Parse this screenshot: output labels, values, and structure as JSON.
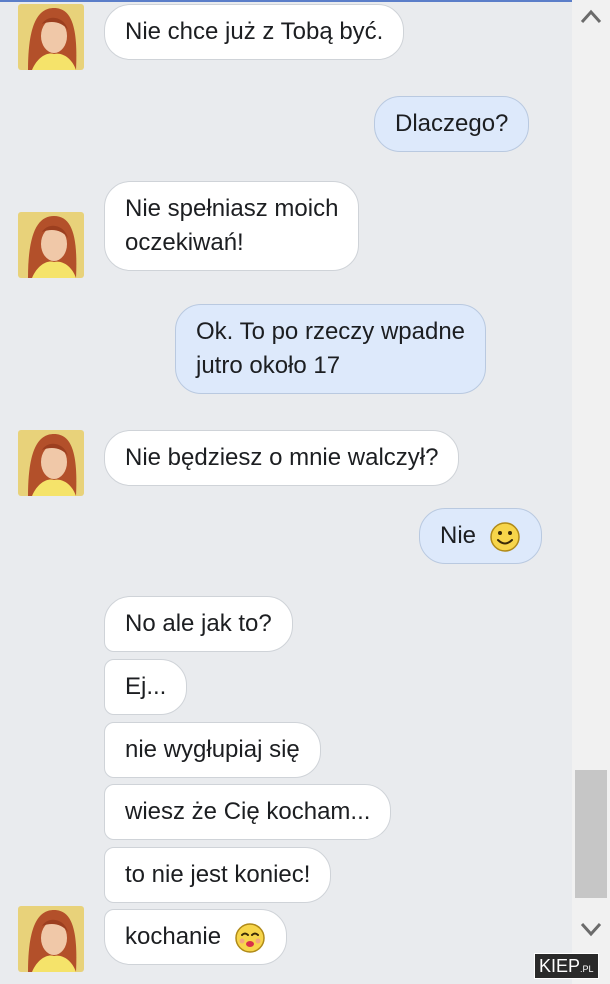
{
  "messages": [
    {
      "side": "in",
      "text": "Nie chce już z Tobą być."
    },
    {
      "side": "out",
      "text": "Dlaczego?"
    },
    {
      "side": "in",
      "lines": [
        "Nie spełniasz moich",
        "oczekiwań!"
      ]
    },
    {
      "side": "out",
      "lines": [
        "Ok. To po rzeczy wpadne",
        "jutro około 17"
      ]
    },
    {
      "side": "in",
      "text": "Nie będziesz o mnie walczył?"
    },
    {
      "side": "out",
      "text": "Nie",
      "emoji": "smiley-icon"
    },
    {
      "side": "in",
      "text": "No ale jak to?"
    },
    {
      "side": "in",
      "text": "Ej..."
    },
    {
      "side": "in",
      "text": "nie wygłupiaj się"
    },
    {
      "side": "in",
      "text": "wiesz że Cię kocham..."
    },
    {
      "side": "in",
      "text": "to nie jest koniec!"
    },
    {
      "side": "in",
      "text": "kochanie",
      "emoji": "kiss-icon"
    }
  ],
  "watermark": {
    "main": "KIEP",
    "suffix": ".PL"
  },
  "colors": {
    "outgoing": "#dde9fb",
    "incoming": "#ffffff",
    "background": "#e9ebee"
  }
}
